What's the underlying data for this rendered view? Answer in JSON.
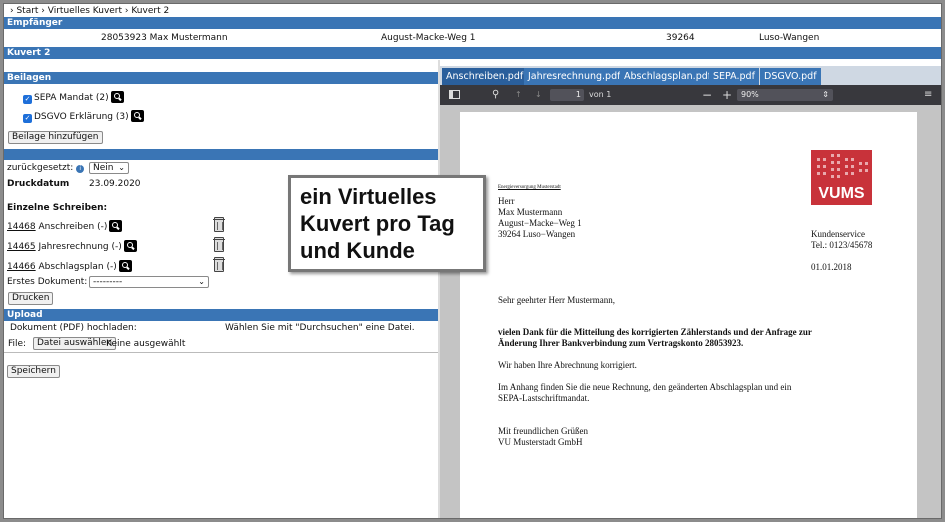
{
  "breadcrumb": "› Start › Virtuelles Kuvert › Kuvert 2",
  "empfaenger": {
    "header": "Empfänger",
    "id_name": "28053923 Max Mustermann",
    "street": "August-Macke-Weg 1",
    "zip": "39264",
    "city": "Luso-Wangen"
  },
  "kuvert_header": "Kuvert 2",
  "beilagen": {
    "header": "Beilagen",
    "items": [
      {
        "label": "SEPA Mandat (2)",
        "checked": true
      },
      {
        "label": "DSGVO Erklärung (3)",
        "checked": true
      }
    ],
    "add_button": "Beilage hinzufügen"
  },
  "details": {
    "reset_label": "zurückgesetzt:",
    "reset_value": "Nein",
    "druckdatum_label": "Druckdatum",
    "druckdatum_value": "23.09.2020",
    "einzelne_label": "Einzelne Schreiben:",
    "schreiben": [
      {
        "id": "14468",
        "label": "Anschreiben (-)"
      },
      {
        "id": "14465",
        "label": "Jahresrechnung (-)"
      },
      {
        "id": "14466",
        "label": "Abschlagsplan (-)"
      }
    ],
    "erstes_label": "Erstes Dokument:",
    "erstes_value": "---------",
    "print_button": "Drucken"
  },
  "upload": {
    "header": "Upload",
    "label": "Dokument (PDF) hochladen:",
    "hint": "Wählen Sie mit \"Durchsuchen\" eine Datei.",
    "file_label": "File:",
    "file_button": "Datei auswählen",
    "file_status": "Keine ausgewählt"
  },
  "save_button": "Speichern",
  "callout": [
    "ein Virtuelles",
    "Kuvert pro Tag",
    "und Kunde"
  ],
  "viewer": {
    "tabs": [
      "Anschreiben.pdf",
      "Jahresrechnung.pdf",
      "Abschlagsplan.pdf",
      "SEPA.pdf",
      "DSGVO.pdf"
    ],
    "active_tab": 0,
    "page_number": "1",
    "page_of": "von 1",
    "zoom": "90%"
  },
  "letter": {
    "sender_line": "Energieversorgung Musterstadt",
    "addr": [
      "Herr",
      "Max Mustermann",
      "August−Macke−Weg 1",
      "39264 Luso−Wangen"
    ],
    "logo_text": "VUMS",
    "service": [
      "Kundenservice",
      "Tel.: 0123/45678"
    ],
    "date": "01.01.2018",
    "greeting": "Sehr geehrter Herr Mustermann,",
    "bold": [
      "vielen Dank für die Mitteilung des korrigierten Zählerstands und der Anfrage zur",
      "Änderung Ihrer Bankverbindung zum Vertragskonto 28053923."
    ],
    "p1": "Wir haben Ihre Abrechnung korrigiert.",
    "p2": [
      "Im Anhang finden Sie die neue Rechnung, den geänderten Abschlagsplan und ein",
      "SEPA-Lastschriftmandat."
    ],
    "closing": [
      "Mit freundlichen Grüßen",
      "VU Musterstadt GmbH"
    ]
  },
  "colors": {
    "accent": "#3a75b5",
    "logo": "#c8323a"
  }
}
